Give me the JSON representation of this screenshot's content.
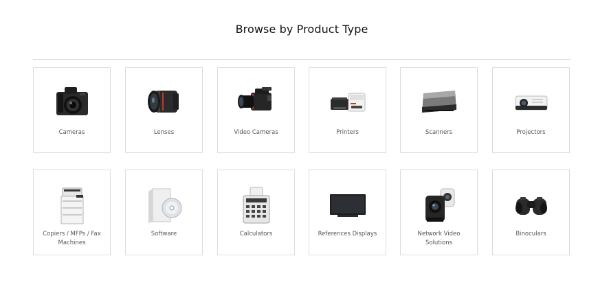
{
  "page_title": "Browse by Product Type",
  "categories": [
    {
      "label": "Cameras",
      "icon": "camera-icon"
    },
    {
      "label": "Lenses",
      "icon": "lens-icon"
    },
    {
      "label": "Video Cameras",
      "icon": "video-camera-icon"
    },
    {
      "label": "Printers",
      "icon": "printer-icon"
    },
    {
      "label": "Scanners",
      "icon": "scanner-icon"
    },
    {
      "label": "Projectors",
      "icon": "projector-icon"
    },
    {
      "label": "Copiers / MFPs / Fax Machines",
      "icon": "copier-icon"
    },
    {
      "label": "Software",
      "icon": "software-icon"
    },
    {
      "label": "Calculators",
      "icon": "calculator-icon"
    },
    {
      "label": "References Displays",
      "icon": "display-icon"
    },
    {
      "label": "Network Video Solutions",
      "icon": "network-camera-icon"
    },
    {
      "label": "Binoculars",
      "icon": "binoculars-icon"
    }
  ]
}
